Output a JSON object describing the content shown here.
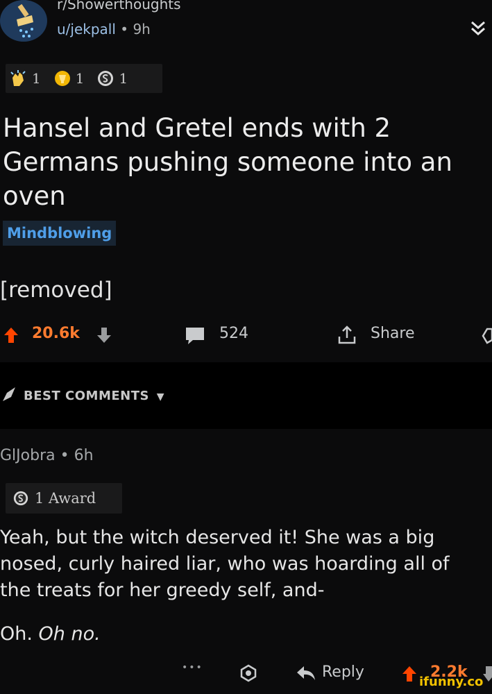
{
  "post": {
    "subreddit": "r/Showerthoughts",
    "author": "u/jekpall",
    "age": "9h",
    "awards": [
      {
        "icon": "clapping-hands-icon",
        "count": "1"
      },
      {
        "icon": "gold-trophy-icon",
        "count": "1"
      },
      {
        "icon": "silver-coin-icon",
        "count": "1"
      }
    ],
    "title": "Hansel and Gretel ends with 2 Germans pushing someone into an oven",
    "flair": "Mindblowing",
    "body": "[removed]",
    "upvotes": "20.6k",
    "comments": "524",
    "share_label": "Share"
  },
  "comments_header": "BEST COMMENTS",
  "comment": {
    "author": "GlJobra",
    "age": "6h",
    "award_label": "1 Award",
    "body": "Yeah, but the witch deserved it! She was a big nosed, curly haired liar, who was hoarding all of the treats for her greedy self, and-",
    "oh_1": "Oh.",
    "oh_2": "Oh no.",
    "more": "•••",
    "reply_label": "Reply",
    "upvotes": "2.2k"
  },
  "watermark": "ifunny.co",
  "colors": {
    "upvote": "#ff7b2f",
    "flair": "#4f9ee8",
    "background": "#0b0b0c"
  }
}
